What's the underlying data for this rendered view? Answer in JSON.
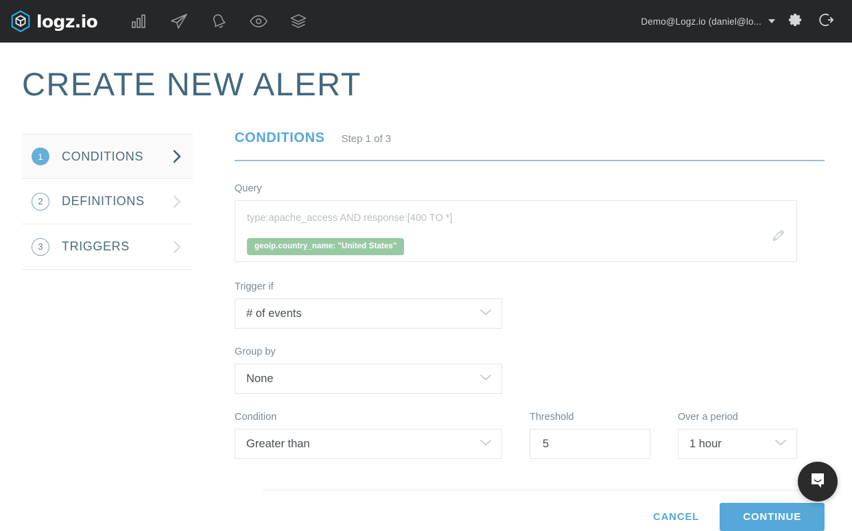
{
  "topbar": {
    "logo_text": "logz.io",
    "nav_icons": [
      {
        "name": "bar-chart-icon",
        "label": "Dashboards"
      },
      {
        "name": "paper-plane-icon",
        "label": "Send"
      },
      {
        "name": "bell-icon",
        "label": "Alerts"
      },
      {
        "name": "eye-icon",
        "label": "Insights"
      },
      {
        "name": "layers-icon",
        "label": "Library"
      }
    ],
    "account_label": "Demo@Logz.io (daniel@lo...",
    "settings_icon": "gear-icon",
    "logout_icon": "logout-icon",
    "background_color": "#262729",
    "logo_accent_color": "#29b5e8"
  },
  "page": {
    "title": "CREATE NEW ALERT",
    "title_color": "#41697f"
  },
  "steps": [
    {
      "number": "1",
      "label": "CONDITIONS",
      "active": true
    },
    {
      "number": "2",
      "label": "DEFINITIONS",
      "active": false
    },
    {
      "number": "3",
      "label": "TRIGGERS",
      "active": false
    }
  ],
  "panel": {
    "title": "CONDITIONS",
    "step_indicator": "Step 1 of 3",
    "title_color": "#56a8d8"
  },
  "form": {
    "query": {
      "label": "Query",
      "text": "type:apache_access AND response:[400 TO *]",
      "placeholder": "type:apache_access AND response:[400 TO *]",
      "tag": "geoip.country_name: \"United States\"",
      "tag_color": "#98c9a3",
      "edit_icon": "pencil-icon"
    },
    "trigger_if": {
      "label": "Trigger if",
      "value": "# of events"
    },
    "group_by": {
      "label": "Group by",
      "value": "None"
    },
    "condition": {
      "label": "Condition",
      "value": "Greater than"
    },
    "threshold": {
      "label": "Threshold",
      "value": "5"
    },
    "over_a_period": {
      "label": "Over a period",
      "value": "1 hour"
    }
  },
  "actions": {
    "cancel_label": "CANCEL",
    "continue_label": "CONTINUE",
    "accent_color": "#56a8d8"
  },
  "intercom": {
    "icon": "chat-bubble-icon"
  }
}
